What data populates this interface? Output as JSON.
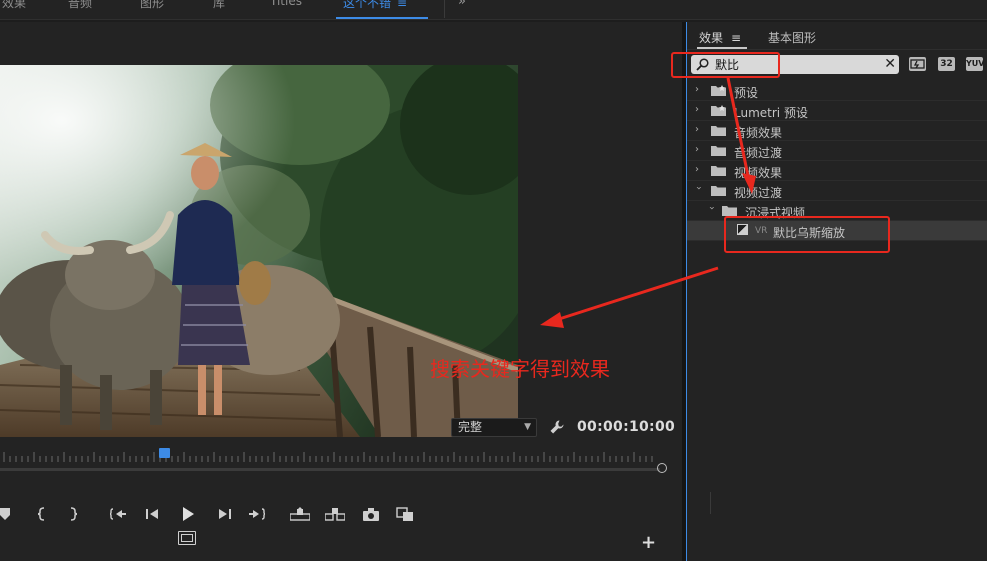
{
  "workspace_tabs": [
    {
      "label": "效果",
      "active": false
    },
    {
      "label": "音频",
      "active": false
    },
    {
      "label": "图形",
      "active": false
    },
    {
      "label": "库",
      "active": false
    },
    {
      "label": "Titles",
      "active": false
    },
    {
      "label": "这个不错",
      "active": true
    }
  ],
  "workspace": {
    "menu_icon": "≡",
    "overflow_icon": "»"
  },
  "monitor": {
    "quality": "完整",
    "timecode": "00:00:10:00",
    "add_icon": "+"
  },
  "annotation": {
    "text": "搜索关键字得到效果"
  },
  "effects_panel": {
    "tab_label": "效果",
    "tab_menu_icon": "≡",
    "other_tab_label": "基本图形",
    "search": {
      "value": "默比",
      "clear_icon": "✕"
    },
    "filter_buttons": [
      "32",
      "YUV"
    ],
    "tree": [
      {
        "label": "预设",
        "expanded": false,
        "level": 0,
        "icon": "preset-folder-icon"
      },
      {
        "label": "Lumetri 预设",
        "expanded": false,
        "level": 0,
        "icon": "preset-folder-icon"
      },
      {
        "label": "音频效果",
        "expanded": false,
        "level": 0,
        "icon": "folder-icon"
      },
      {
        "label": "音频过渡",
        "expanded": false,
        "level": 0,
        "icon": "folder-icon"
      },
      {
        "label": "视频效果",
        "expanded": false,
        "level": 0,
        "icon": "folder-icon"
      },
      {
        "label": "视频过渡",
        "expanded": true,
        "level": 0,
        "icon": "folder-icon"
      },
      {
        "label": "沉浸式视频",
        "expanded": true,
        "level": 1,
        "icon": "folder-icon"
      },
      {
        "label": "默比乌斯缩放",
        "tag": "VR",
        "level": 2,
        "icon": "transition-icon",
        "selected": true
      }
    ]
  },
  "colors": {
    "accent": "#3d8be6",
    "annotation_red": "#e8281e",
    "panel_bg": "#232323"
  }
}
